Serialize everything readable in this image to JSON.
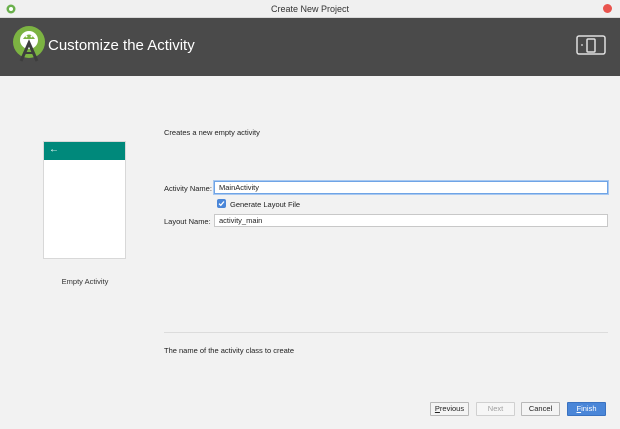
{
  "window": {
    "title": "Create New Project"
  },
  "header": {
    "title": "Customize the Activity"
  },
  "preview": {
    "label": "Empty Activity",
    "back_glyph": "←"
  },
  "description": "Creates a new empty activity",
  "form": {
    "activity_name_label": "Activity Name:",
    "activity_name_value": "MainActivity",
    "generate_layout_label": "Generate Layout File",
    "generate_layout_checked": true,
    "layout_name_label": "Layout Name:",
    "layout_name_value": "activity_main"
  },
  "help_text": "The name of the activity class to create",
  "buttons": {
    "previous": "Previous",
    "next": "Next",
    "cancel": "Cancel",
    "finish": "Finish"
  },
  "colors": {
    "header_bg": "#4a4a4a",
    "appbar": "#00897b",
    "accent": "#4a86d8",
    "close": "#e9544e"
  }
}
